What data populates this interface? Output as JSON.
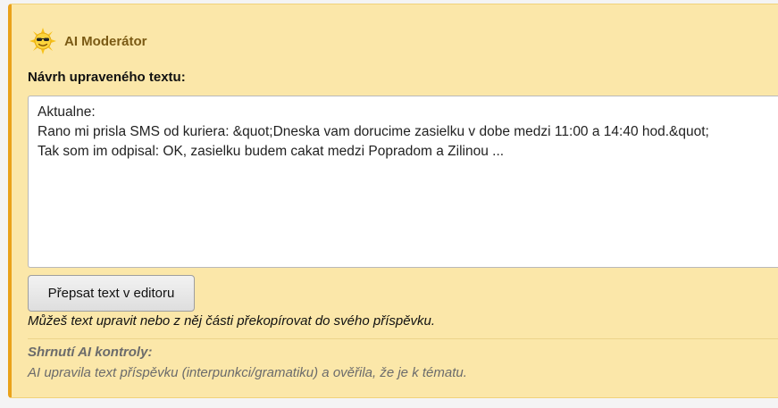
{
  "moderator": {
    "title": "AI Moderátor",
    "icon": "sun-sunglasses-icon"
  },
  "suggestion": {
    "label": "Návrh upraveného textu:",
    "text": "Aktualne:\nRano mi prisla SMS od kuriera: &quot;Dneska vam dorucime zasielku v dobe medzi 11:00 a 14:40 hod.&quot;\nTak som im odpisal: OK, zasielku budem cakat medzi Popradom a Zilinou ..."
  },
  "actions": {
    "rewrite_button": "Přepsat text v editoru"
  },
  "hint": "Můžeš text upravit nebo z něj části překopírovat do svého příspěvku.",
  "summary": {
    "title": "Shrnutí AI kontroly:",
    "text": "AI upravila text příspěvku (interpunkci/gramatiku) a ověřila, že je k tématu."
  },
  "colors": {
    "panel_background": "#fbe7a9",
    "panel_accent": "#eaa21a",
    "title_text": "#7a5a14",
    "muted_text": "#6b6b6b"
  }
}
